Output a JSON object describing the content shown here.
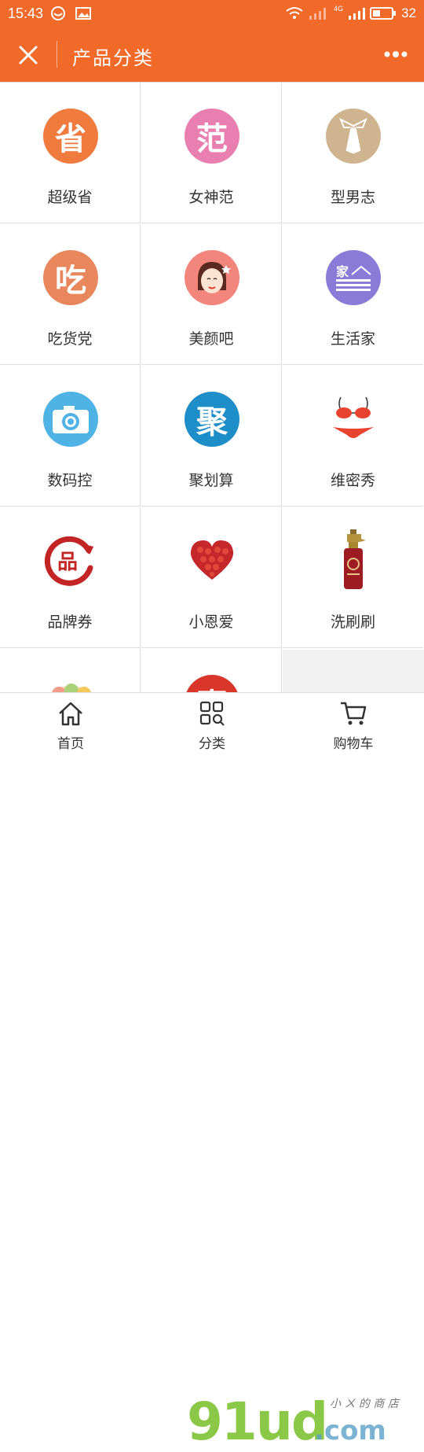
{
  "status_bar": {
    "time": "15:43",
    "network": "4G",
    "battery": "32"
  },
  "header": {
    "title": "产品分类"
  },
  "categories": [
    {
      "label": "超级省",
      "glyph": "省",
      "color": "#f07b3f",
      "icon": "sheng-icon"
    },
    {
      "label": "女神范",
      "glyph": "范",
      "color": "#e97fb0",
      "icon": "fan-icon"
    },
    {
      "label": "型男志",
      "glyph": "",
      "color": "#cfb58f",
      "icon": "tie-icon"
    },
    {
      "label": "吃货党",
      "glyph": "吃",
      "color": "#e8875c",
      "icon": "chi-icon"
    },
    {
      "label": "美颜吧",
      "glyph": "",
      "color": "#f2857c",
      "icon": "face-icon"
    },
    {
      "label": "生活家",
      "glyph": "家",
      "color": "#8b7bd8",
      "icon": "home-icon"
    },
    {
      "label": "数码控",
      "glyph": "",
      "color": "#4fb3e6",
      "icon": "camera-icon"
    },
    {
      "label": "聚划算",
      "glyph": "聚",
      "color": "#1e8ec8",
      "icon": "ju-icon"
    },
    {
      "label": "维密秀",
      "glyph": "",
      "color": "#ffffff",
      "icon": "bikini-icon"
    },
    {
      "label": "品牌券",
      "glyph": "品",
      "color": "#ffffff",
      "icon": "brand-coupon-icon"
    },
    {
      "label": "小恩爱",
      "glyph": "",
      "color": "#ffffff",
      "icon": "heart-icon"
    },
    {
      "label": "洗刷刷",
      "glyph": "",
      "color": "#ffffff",
      "icon": "shampoo-icon"
    },
    {
      "label": "",
      "glyph": "",
      "color": "#ffffff",
      "icon": "macaron-icon"
    },
    {
      "label": "",
      "glyph": "惠",
      "color": "#d9352b",
      "icon": "hui-icon"
    }
  ],
  "tabs": [
    {
      "label": "首页",
      "icon": "home-tab-icon"
    },
    {
      "label": "分类",
      "icon": "category-tab-icon"
    },
    {
      "label": "购物车",
      "icon": "cart-tab-icon"
    }
  ],
  "watermark": {
    "main": "91ud",
    "sub": ".com",
    "small": "小 ㄨ 的 商 店"
  }
}
